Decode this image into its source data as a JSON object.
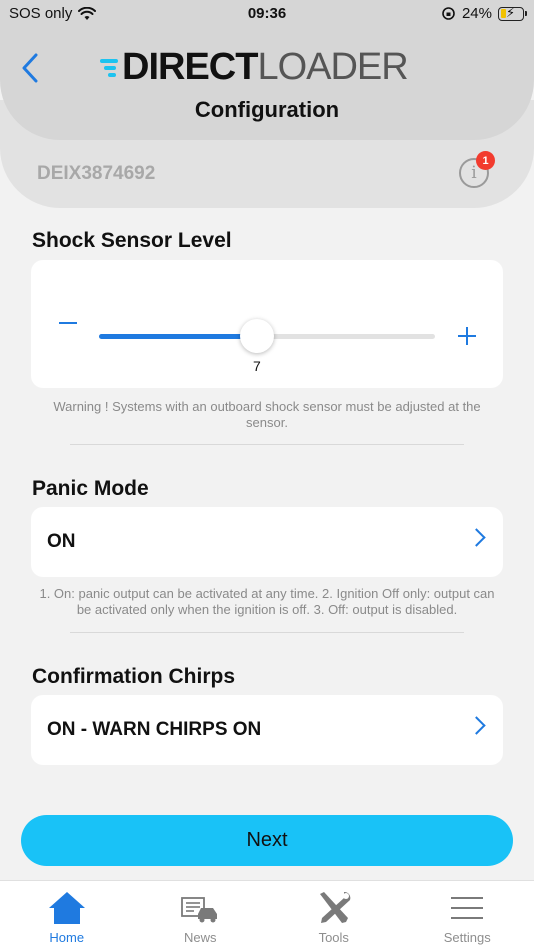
{
  "status_bar": {
    "carrier": "SOS only",
    "time": "09:36",
    "battery": "24%",
    "battery_level": 0.24
  },
  "header": {
    "logo_direct": "DIRECT",
    "logo_loader": "LOADER",
    "title": "Configuration",
    "device_id": "DEIX3874692",
    "info_badge": "1"
  },
  "shock": {
    "title": "Shock Sensor Level",
    "value": "7",
    "fill_fraction": 0.47,
    "note": "Warning ! Systems with an outboard shock sensor must be adjusted at the sensor."
  },
  "panic": {
    "title": "Panic Mode",
    "value": "ON",
    "note": "1. On: panic output can be activated at any time. 2. Ignition Off only: output can be activated only when the ignition is off. 3. Off: output is disabled."
  },
  "chirps": {
    "title": "Confirmation Chirps",
    "value": "ON - WARN CHIRPS ON"
  },
  "next_label": "Next",
  "tabs": [
    {
      "label": "Home",
      "icon": "home-icon",
      "active": true
    },
    {
      "label": "News",
      "icon": "news-icon",
      "active": false
    },
    {
      "label": "Tools",
      "icon": "tools-icon",
      "active": false
    },
    {
      "label": "Settings",
      "icon": "menu-icon",
      "active": false
    }
  ],
  "colors": {
    "accent": "#1f7ae0",
    "next_button": "#19c2f7",
    "badge": "#f23b2e"
  }
}
